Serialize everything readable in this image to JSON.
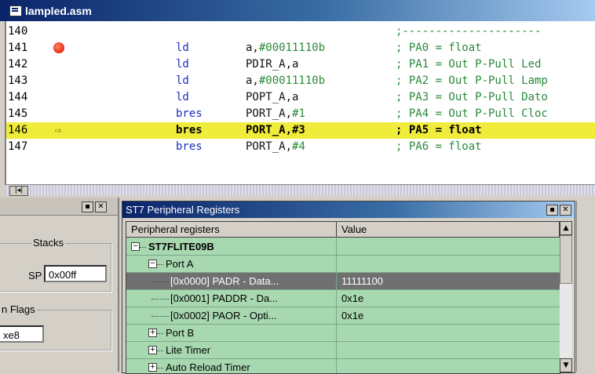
{
  "editor": {
    "title": "lampled.asm",
    "lines": [
      {
        "num": "140",
        "marker": "",
        "op": "",
        "arg": "",
        "arg_num": "",
        "cmt": ";---------------------",
        "hl": false
      },
      {
        "num": "141",
        "marker": "breakpoint",
        "op": "ld",
        "arg": "a,",
        "arg_num": "#00011110b",
        "cmt": "; PA0 = float",
        "hl": false
      },
      {
        "num": "142",
        "marker": "",
        "op": "ld",
        "arg": "PDIR_A,a",
        "arg_num": "",
        "cmt": "; PA1 = Out P-Pull Led",
        "hl": false
      },
      {
        "num": "143",
        "marker": "",
        "op": "ld",
        "arg": "a,",
        "arg_num": "#00011110b",
        "cmt": "; PA2 = Out P-Pull Lamp",
        "hl": false
      },
      {
        "num": "144",
        "marker": "",
        "op": "ld",
        "arg": "POPT_A,a",
        "arg_num": "",
        "cmt": "; PA3 = Out P-Pull Dato",
        "hl": false
      },
      {
        "num": "145",
        "marker": "",
        "op": "bres",
        "arg": "PORT_A,",
        "arg_num": "#1",
        "cmt": "; PA4 = Out P-Pull Cloc",
        "hl": false
      },
      {
        "num": "146",
        "marker": "current",
        "op": "bres",
        "arg": "PORT_A,#3",
        "arg_num": "",
        "cmt": "; PA5 = float",
        "hl": true
      },
      {
        "num": "147",
        "marker": "",
        "op": "bres",
        "arg": "PORT_A,",
        "arg_num": "#4",
        "cmt": "; PA6 = float",
        "hl": false
      }
    ],
    "scroll_btn": "|◂|"
  },
  "left_panel": {
    "stacks_label": "Stacks",
    "sp_label": "SP",
    "sp_value": "0x00ff",
    "flags_label": "n Flags",
    "flags_value": "xe8",
    "min_btn": "▪",
    "close_btn": "✕"
  },
  "peripheral": {
    "title": "ST7 Peripheral Registers",
    "min_btn": "▪",
    "close_btn": "✕",
    "columns": [
      "Peripheral registers",
      "Value"
    ],
    "rows": [
      {
        "label": "ST7FLITE09B",
        "value": "",
        "toggle": "−",
        "level": 0,
        "bold": true,
        "selected": false
      },
      {
        "label": "Port A",
        "value": "",
        "toggle": "−",
        "level": 1,
        "bold": false,
        "selected": false
      },
      {
        "label": "[0x0000] PADR - Data...",
        "value": "11111100",
        "toggle": "",
        "level": 2,
        "bold": false,
        "selected": true
      },
      {
        "label": "[0x0001] PADDR - Da...",
        "value": "0x1e",
        "toggle": "",
        "level": 2,
        "bold": false,
        "selected": false
      },
      {
        "label": "[0x0002] PAOR - Opti...",
        "value": "0x1e",
        "toggle": "",
        "level": 2,
        "bold": false,
        "selected": false
      },
      {
        "label": "Port B",
        "value": "",
        "toggle": "+",
        "level": 1,
        "bold": false,
        "selected": false
      },
      {
        "label": "Lite Timer",
        "value": "",
        "toggle": "+",
        "level": 1,
        "bold": false,
        "selected": false
      },
      {
        "label": "Auto Reload Timer",
        "value": "",
        "toggle": "+",
        "level": 1,
        "bold": false,
        "selected": false
      }
    ],
    "scroll_up": "▲",
    "scroll_down": "▼"
  }
}
